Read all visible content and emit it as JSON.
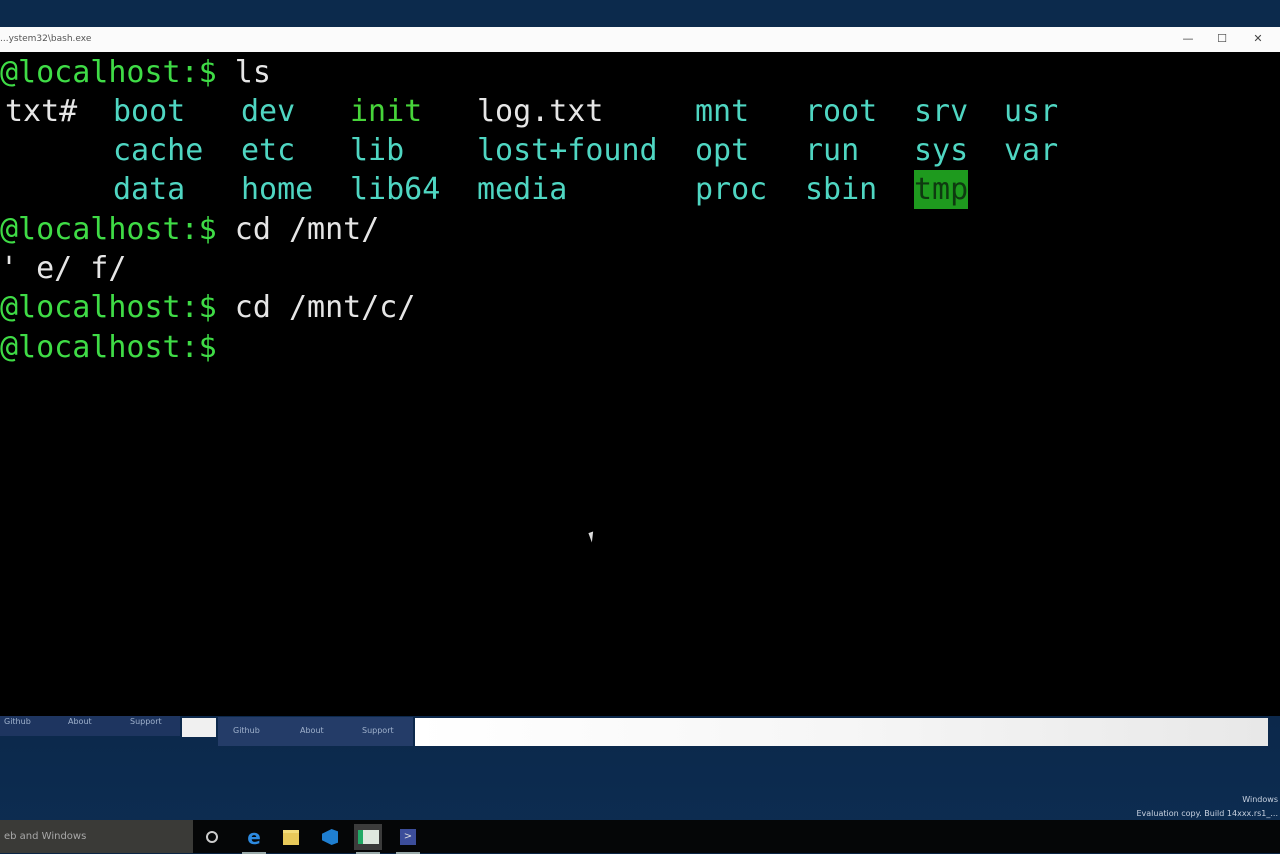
{
  "window": {
    "title": "...ystem32\\bash.exe",
    "controls": [
      "—",
      "☐",
      "✕"
    ]
  },
  "terminal": {
    "prompt": "@localhost:$",
    "lines": [
      {
        "cmd": " ls"
      },
      {
        "cmd": " cd /mnt/"
      },
      {
        "cmd": " cd /mnt/c/"
      },
      {
        "cmd": ""
      }
    ],
    "completion_output": "' e/ f/",
    "ls_rows": [
      [
        {
          "t": "txt#",
          "k": "plain"
        },
        {
          "t": "boot",
          "k": "dir"
        },
        {
          "t": "dev",
          "k": "dir"
        },
        {
          "t": "init",
          "k": "exec"
        },
        {
          "t": "log.txt",
          "k": "plain"
        },
        {
          "t": "mnt",
          "k": "dir"
        },
        {
          "t": "root",
          "k": "dir"
        },
        {
          "t": "srv",
          "k": "dir"
        },
        {
          "t": "usr",
          "k": "dir"
        }
      ],
      [
        null,
        {
          "t": "cache",
          "k": "dir"
        },
        {
          "t": "etc",
          "k": "dir"
        },
        {
          "t": "lib",
          "k": "dir"
        },
        {
          "t": "lost+found",
          "k": "dir"
        },
        {
          "t": "opt",
          "k": "dir"
        },
        {
          "t": "run",
          "k": "dir"
        },
        {
          "t": "sys",
          "k": "dir"
        },
        {
          "t": "var",
          "k": "dir"
        }
      ],
      [
        null,
        {
          "t": "data",
          "k": "dir"
        },
        {
          "t": "home",
          "k": "dir"
        },
        {
          "t": "lib64",
          "k": "dir"
        },
        {
          "t": "media",
          "k": "dir"
        },
        {
          "t": "proc",
          "k": "dir"
        },
        {
          "t": "sbin",
          "k": "dir"
        },
        {
          "t": "tmp",
          "k": "hl"
        },
        null
      ]
    ],
    "colors": {
      "prompt": "#3fdc46",
      "dir": "#4fd6c2",
      "exec": "#47d43a",
      "highlight_bg": "#1e9a1e",
      "background": "#000000"
    }
  },
  "background_page": {
    "links_left": [
      "Github",
      "About",
      "Support"
    ],
    "links_right": [
      "Github",
      "About",
      "Support"
    ]
  },
  "taskbar": {
    "search_placeholder": "eb and Windows",
    "icons": [
      "cortana-icon",
      "edge-icon",
      "file-explorer-icon",
      "visual-studio-icon",
      "bash-icon",
      "terminal-icon"
    ]
  },
  "watermark": {
    "line1": "Windows",
    "line2": "Evaluation copy. Build 14xxx.rs1_..."
  }
}
